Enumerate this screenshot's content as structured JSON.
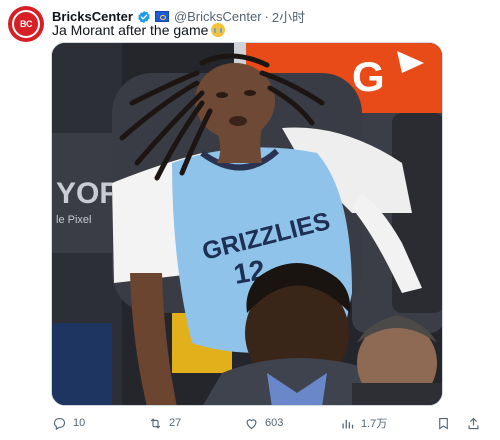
{
  "author": {
    "display_name": "BricksCenter",
    "handle": "@BricksCenter",
    "separator": "·",
    "time": "2小时",
    "avatar_text": "BC",
    "verified_icon": "verified-badge-icon",
    "flag_icon": "flag-icon"
  },
  "tweet": {
    "text": "Ja Morant after the game",
    "emoji_icon": "crying-face-emoji"
  },
  "media": {
    "jersey_text": "GRIZZLIES",
    "jersey_number": "12",
    "gatorade_text": "G",
    "sign_text": "YOF",
    "sign_text2": "le Pixel"
  },
  "actions": {
    "reply_count": "10",
    "retweet_count": "27",
    "like_count": "603",
    "views_count": "1.7万"
  },
  "colors": {
    "accent": "#1d9bf0",
    "muted": "#536471",
    "jersey": "#8fc3ea",
    "gatorade": "#f05a1a"
  }
}
